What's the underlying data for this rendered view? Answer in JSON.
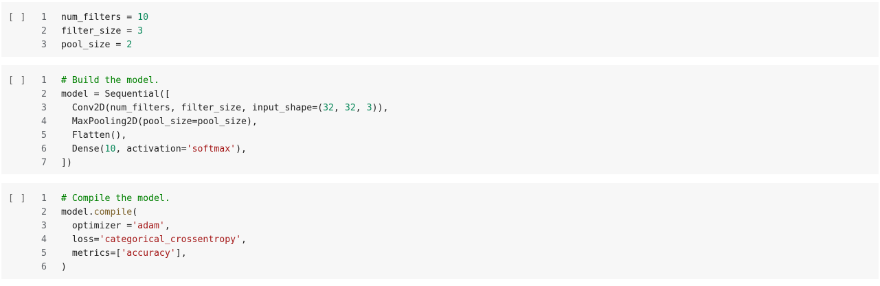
{
  "cells": [
    {
      "run_label": "[ ]",
      "lines": [
        {
          "n": "1",
          "tokens": [
            {
              "t": "num_filters = ",
              "c": "plain"
            },
            {
              "t": "10",
              "c": "num"
            }
          ]
        },
        {
          "n": "2",
          "tokens": [
            {
              "t": "filter_size = ",
              "c": "plain"
            },
            {
              "t": "3",
              "c": "num"
            }
          ]
        },
        {
          "n": "3",
          "tokens": [
            {
              "t": "pool_size = ",
              "c": "plain"
            },
            {
              "t": "2",
              "c": "num"
            }
          ]
        }
      ]
    },
    {
      "run_label": "[ ]",
      "lines": [
        {
          "n": "1",
          "tokens": [
            {
              "t": "# Build the model.",
              "c": "com"
            }
          ]
        },
        {
          "n": "2",
          "tokens": [
            {
              "t": "model = Sequential([",
              "c": "plain"
            }
          ]
        },
        {
          "n": "3",
          "tokens": [
            {
              "t": "  Conv2D(num_filters, filter_size, input_shape=(",
              "c": "plain"
            },
            {
              "t": "32",
              "c": "num"
            },
            {
              "t": ", ",
              "c": "plain"
            },
            {
              "t": "32",
              "c": "num"
            },
            {
              "t": ", ",
              "c": "plain"
            },
            {
              "t": "3",
              "c": "num"
            },
            {
              "t": ")),",
              "c": "plain"
            }
          ]
        },
        {
          "n": "4",
          "tokens": [
            {
              "t": "  MaxPooling2D(pool_size=pool_size),",
              "c": "plain"
            }
          ]
        },
        {
          "n": "5",
          "tokens": [
            {
              "t": "  Flatten(),",
              "c": "plain"
            }
          ]
        },
        {
          "n": "6",
          "tokens": [
            {
              "t": "  Dense(",
              "c": "plain"
            },
            {
              "t": "10",
              "c": "num"
            },
            {
              "t": ", activation=",
              "c": "plain"
            },
            {
              "t": "'softmax'",
              "c": "str"
            },
            {
              "t": "),",
              "c": "plain"
            }
          ]
        },
        {
          "n": "7",
          "tokens": [
            {
              "t": "])",
              "c": "plain"
            }
          ]
        }
      ]
    },
    {
      "run_label": "[ ]",
      "lines": [
        {
          "n": "1",
          "tokens": [
            {
              "t": "# Compile the model.",
              "c": "com"
            }
          ]
        },
        {
          "n": "2",
          "tokens": [
            {
              "t": "model.",
              "c": "plain"
            },
            {
              "t": "compile",
              "c": "fn"
            },
            {
              "t": "(",
              "c": "plain"
            }
          ]
        },
        {
          "n": "3",
          "tokens": [
            {
              "t": "  optimizer =",
              "c": "plain"
            },
            {
              "t": "'adam'",
              "c": "str"
            },
            {
              "t": ",",
              "c": "plain"
            }
          ]
        },
        {
          "n": "4",
          "tokens": [
            {
              "t": "  loss=",
              "c": "plain"
            },
            {
              "t": "'categorical_crossentropy'",
              "c": "str"
            },
            {
              "t": ",",
              "c": "plain"
            }
          ]
        },
        {
          "n": "5",
          "tokens": [
            {
              "t": "  metrics=[",
              "c": "plain"
            },
            {
              "t": "'accuracy'",
              "c": "str"
            },
            {
              "t": "],",
              "c": "plain"
            }
          ]
        },
        {
          "n": "6",
          "tokens": [
            {
              "t": ")",
              "c": "plain"
            }
          ]
        }
      ]
    }
  ],
  "colors": {
    "cell_bg": "#f7f7f7",
    "number": "#09885a",
    "string": "#a31515",
    "comment": "#008000",
    "function": "#795e26",
    "text": "#212121",
    "line_number": "#5f6368"
  }
}
